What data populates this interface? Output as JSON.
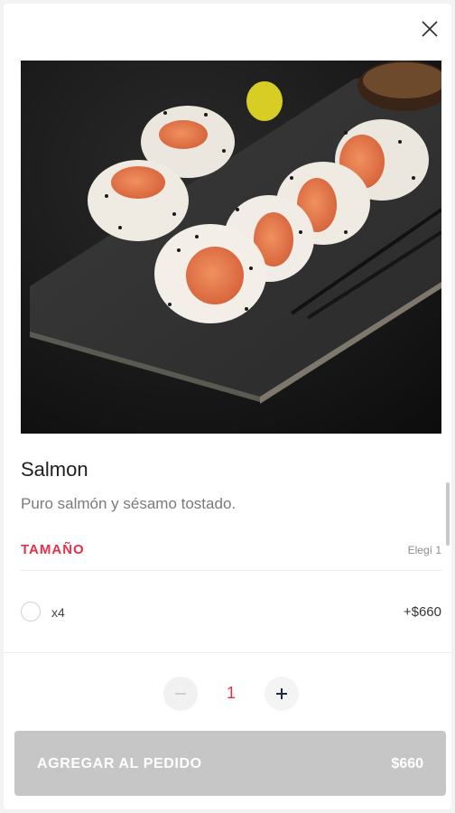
{
  "product": {
    "title": "Salmon",
    "description": "Puro salmón y sésamo tostado.",
    "image_alt": "sushi-salmon-rolls-photo"
  },
  "options_section": {
    "title": "TAMAÑO",
    "hint": "Elegí 1",
    "options": [
      {
        "label": "x4",
        "price": "+$660",
        "selected": false
      }
    ]
  },
  "quantity": {
    "value": "1"
  },
  "cta": {
    "label": "AGREGAR AL PEDIDO",
    "price": "$660"
  },
  "icons": {
    "close": "close-icon",
    "minus": "minus-icon",
    "plus": "plus-icon"
  },
  "colors": {
    "accent": "#e8304a",
    "cta_disabled": "#c6c6c6",
    "stepper_plus": "#1f2a44"
  }
}
